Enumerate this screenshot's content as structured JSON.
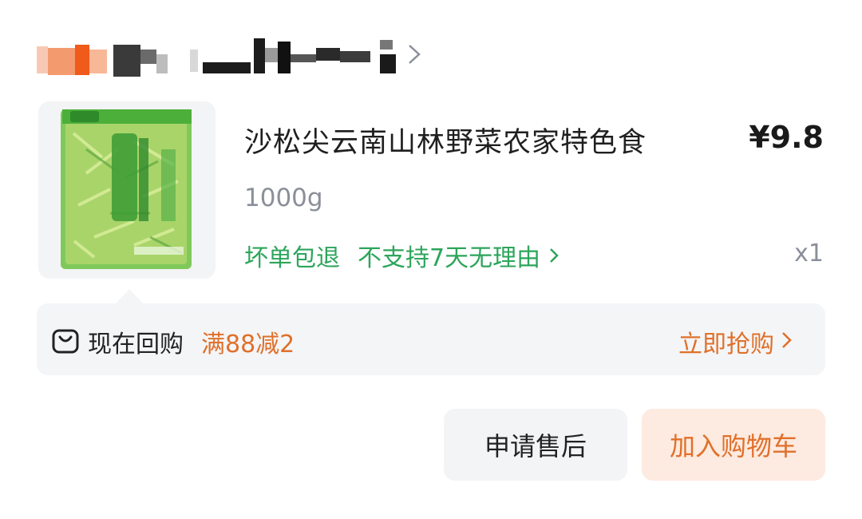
{
  "store": {
    "name_redacted": true
  },
  "product": {
    "title": "沙松尖云南山林野菜农家特色食",
    "price": "¥9.8",
    "spec": "1000g",
    "tags": [
      "坏单包退",
      "不支持7天无理由"
    ],
    "quantity": "x1",
    "image_icon": "vegetable-package-image"
  },
  "repurchase": {
    "label": "现在回购",
    "promo": "满88减2",
    "action": "立即抢购"
  },
  "buttons": {
    "after_sale": "申请售后",
    "add_to_cart": "加入购物车"
  },
  "colors": {
    "accent_orange": "#e0702a",
    "tag_green": "#2da55b",
    "muted_gray": "#8a8f99",
    "cart_button_bg": "#fdeae0",
    "banner_bg": "#f4f5f7"
  }
}
